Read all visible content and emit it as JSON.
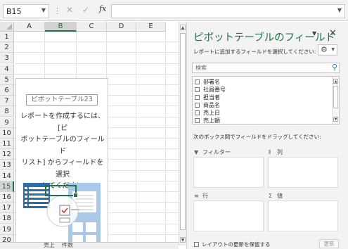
{
  "formula_bar": {
    "name_box": "B15",
    "separator": "⋮",
    "cancel_glyph": "✕",
    "enter_glyph": "✓",
    "fx_label": "fx",
    "formula_value": ""
  },
  "grid": {
    "columns": [
      "A",
      "B",
      "C",
      "D",
      "E"
    ],
    "selected_column": "B",
    "rows": [
      "1",
      "2",
      "3",
      "4",
      "5",
      "6",
      "7",
      "8",
      "9",
      "10",
      "11",
      "12",
      "13",
      "14",
      "15",
      "16",
      "17",
      "18",
      "19",
      "20"
    ],
    "selected_row": "15"
  },
  "pivot_placeholder": {
    "name": "ピボットテーブル23",
    "message_lines": [
      "レポートを作成するには、[ピ",
      "ボットテーブルのフィールド",
      "リスト] からフィールドを選択",
      "してください"
    ]
  },
  "sheet_tabs": {
    "visible_text": [
      "売上",
      "件数"
    ]
  },
  "field_pane": {
    "title": "ピボットテーブルのフィールド",
    "subtitle": "レポートに追加するフィールドを選択してください:",
    "search_placeholder": "検索",
    "fields": [
      {
        "label": "部署名",
        "checked": false
      },
      {
        "label": "社員番号",
        "checked": false
      },
      {
        "label": "担当者",
        "checked": false
      },
      {
        "label": "商品名",
        "checked": false
      },
      {
        "label": "売上日",
        "checked": false
      },
      {
        "label": "売上額",
        "checked": false
      }
    ],
    "drag_hint": "次のボックス間でフィールドをドラッグしてください:",
    "areas": {
      "filter": "フィルター",
      "columns": "列",
      "rows": "行",
      "values": "値"
    },
    "defer_label": "レイアウトの更新を保留する",
    "update_button": "更新",
    "accent_color": "#217346"
  }
}
